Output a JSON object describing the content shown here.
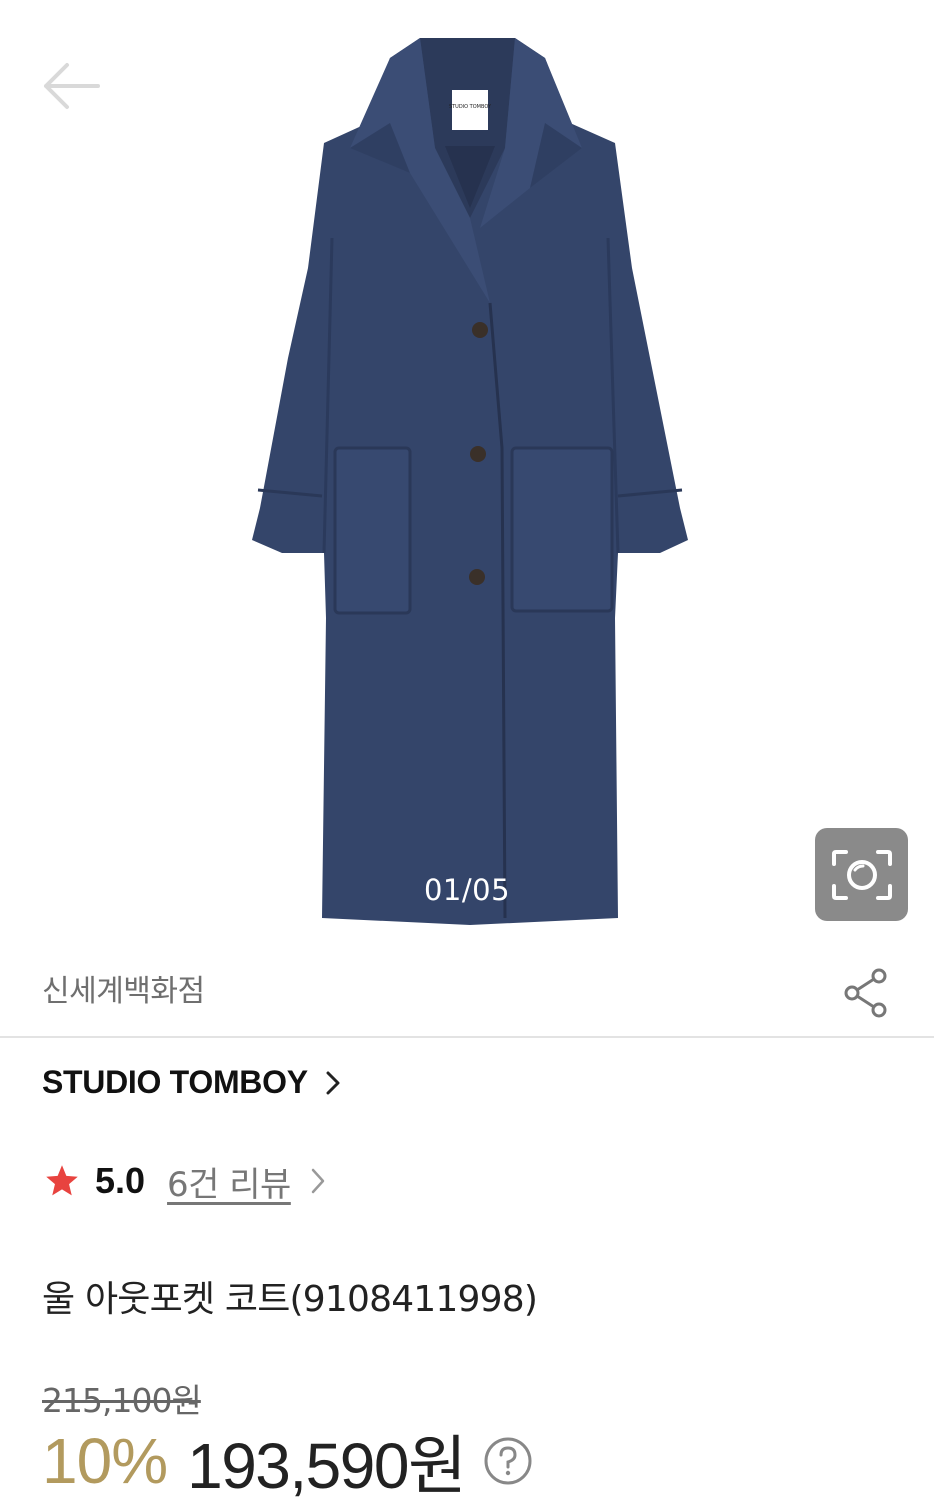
{
  "gallery": {
    "page_indicator": "01/05",
    "label_text": "STUDIO TOMBOY",
    "icons": {
      "back": "arrow-left-icon",
      "lens": "camera-search-icon"
    },
    "colors": {
      "coat": "#34456a",
      "lens_button_bg": "#8a8a8a"
    }
  },
  "store": {
    "name": "신세계백화점",
    "share_icon": "share-icon"
  },
  "brand": {
    "name": "STUDIO TOMBOY",
    "chevron_icon": "chevron-right-icon"
  },
  "rating": {
    "score": "5.0",
    "review_link": "6건 리뷰",
    "star_color": "#e8433f"
  },
  "product": {
    "name": "울 아웃포켓 코트(9108411998)"
  },
  "price": {
    "original": "215,100원",
    "discount": "10%",
    "sale": "193,590원",
    "discount_color": "#b29a5e",
    "help_icon": "question-circle-icon"
  }
}
